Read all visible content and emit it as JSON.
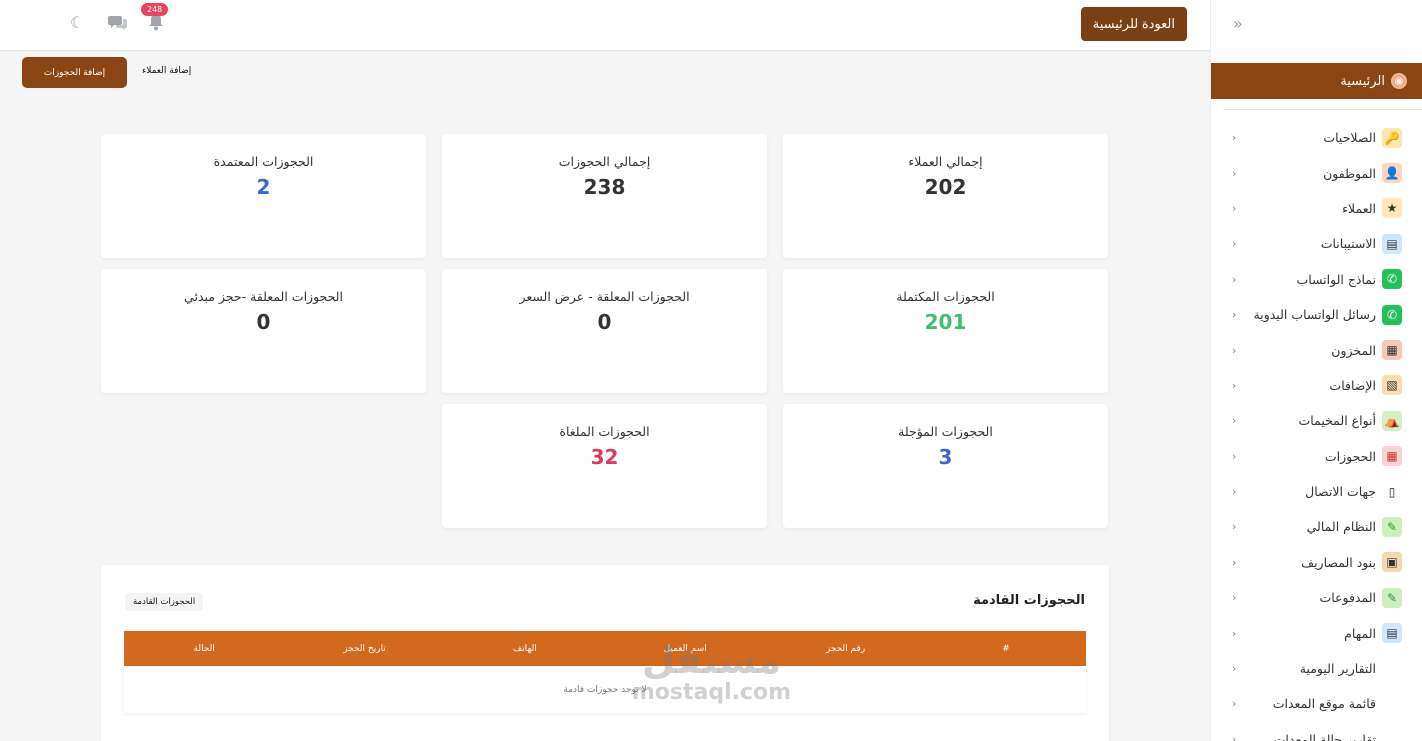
{
  "topbar": {
    "home_button": "العودة للرئيسية",
    "notifications_count": "248"
  },
  "subbar": {
    "add_bookings": "إضافة الحجوزات",
    "add_customers": "إضافة العملاء"
  },
  "sidebar": {
    "home": "الرئيسية",
    "items": [
      {
        "label": "الصلاحيات",
        "icon": "key-icon"
      },
      {
        "label": "الموظفون",
        "icon": "employee-icon"
      },
      {
        "label": "العملاء",
        "icon": "customers-icon"
      },
      {
        "label": "الاستيبانات",
        "icon": "survey-icon"
      },
      {
        "label": "نماذج الواتساب",
        "icon": "whatsapp-icon"
      },
      {
        "label": "رسائل الواتساب اليدوية",
        "icon": "whatsapp-icon"
      },
      {
        "label": "المخزون",
        "icon": "inventory-icon"
      },
      {
        "label": "الإضافات",
        "icon": "addons-icon"
      },
      {
        "label": "أنواع المخيمات",
        "icon": "camp-icon"
      },
      {
        "label": "الحجوزات",
        "icon": "calendar-icon"
      },
      {
        "label": "جهات الاتصال",
        "icon": "phone-icon"
      },
      {
        "label": "النظام المالي",
        "icon": "money-icon"
      },
      {
        "label": "بنود المصاريف",
        "icon": "expenses-icon"
      },
      {
        "label": "المدفوعات",
        "icon": "payments-icon"
      },
      {
        "label": "المهام",
        "icon": "tasks-icon"
      },
      {
        "label": "التقارير اليومية",
        "icon": ""
      },
      {
        "label": "قائمة موقع المعدات",
        "icon": ""
      },
      {
        "label": "تقارير حالة المعدات",
        "icon": ""
      }
    ]
  },
  "stats": {
    "total_customers": {
      "title": "إجمالي العملاء",
      "value": "202"
    },
    "total_bookings": {
      "title": "إجمالي الحجوزات",
      "value": "238"
    },
    "approved_bookings": {
      "title": "الحجوزات المعتمدة",
      "value": "2"
    },
    "completed_bookings": {
      "title": "الحجوزات المكتملة",
      "value": "201"
    },
    "pending_price": {
      "title": "الحجوزات المعلقة - عرض السعر",
      "value": "0"
    },
    "pending_initial": {
      "title": "الحجوزات المعلقة -حجز مبدئي",
      "value": "0"
    },
    "postponed_bookings": {
      "title": "الحجوزات المؤجلة",
      "value": "3"
    },
    "cancelled_bookings": {
      "title": "الحجوزات الملغاة",
      "value": "32"
    }
  },
  "colors": {
    "brand": "#8b4513",
    "table_header": "#d2691e",
    "blue": "#3a67d8",
    "green": "#3fbf6f",
    "red": "#e0395a"
  },
  "upcoming": {
    "title": "الحجوزات القادمة",
    "tag": "الحجوزات القادمة",
    "columns": [
      "#",
      "رقم الحجز",
      "اسم العميل",
      "الهاتف",
      "تاريخ الحجز",
      "الحالة"
    ],
    "empty": "لا توجد حجوزات قادمة"
  },
  "watermark": {
    "ar": "مستقل",
    "en": "mostaql.com"
  }
}
